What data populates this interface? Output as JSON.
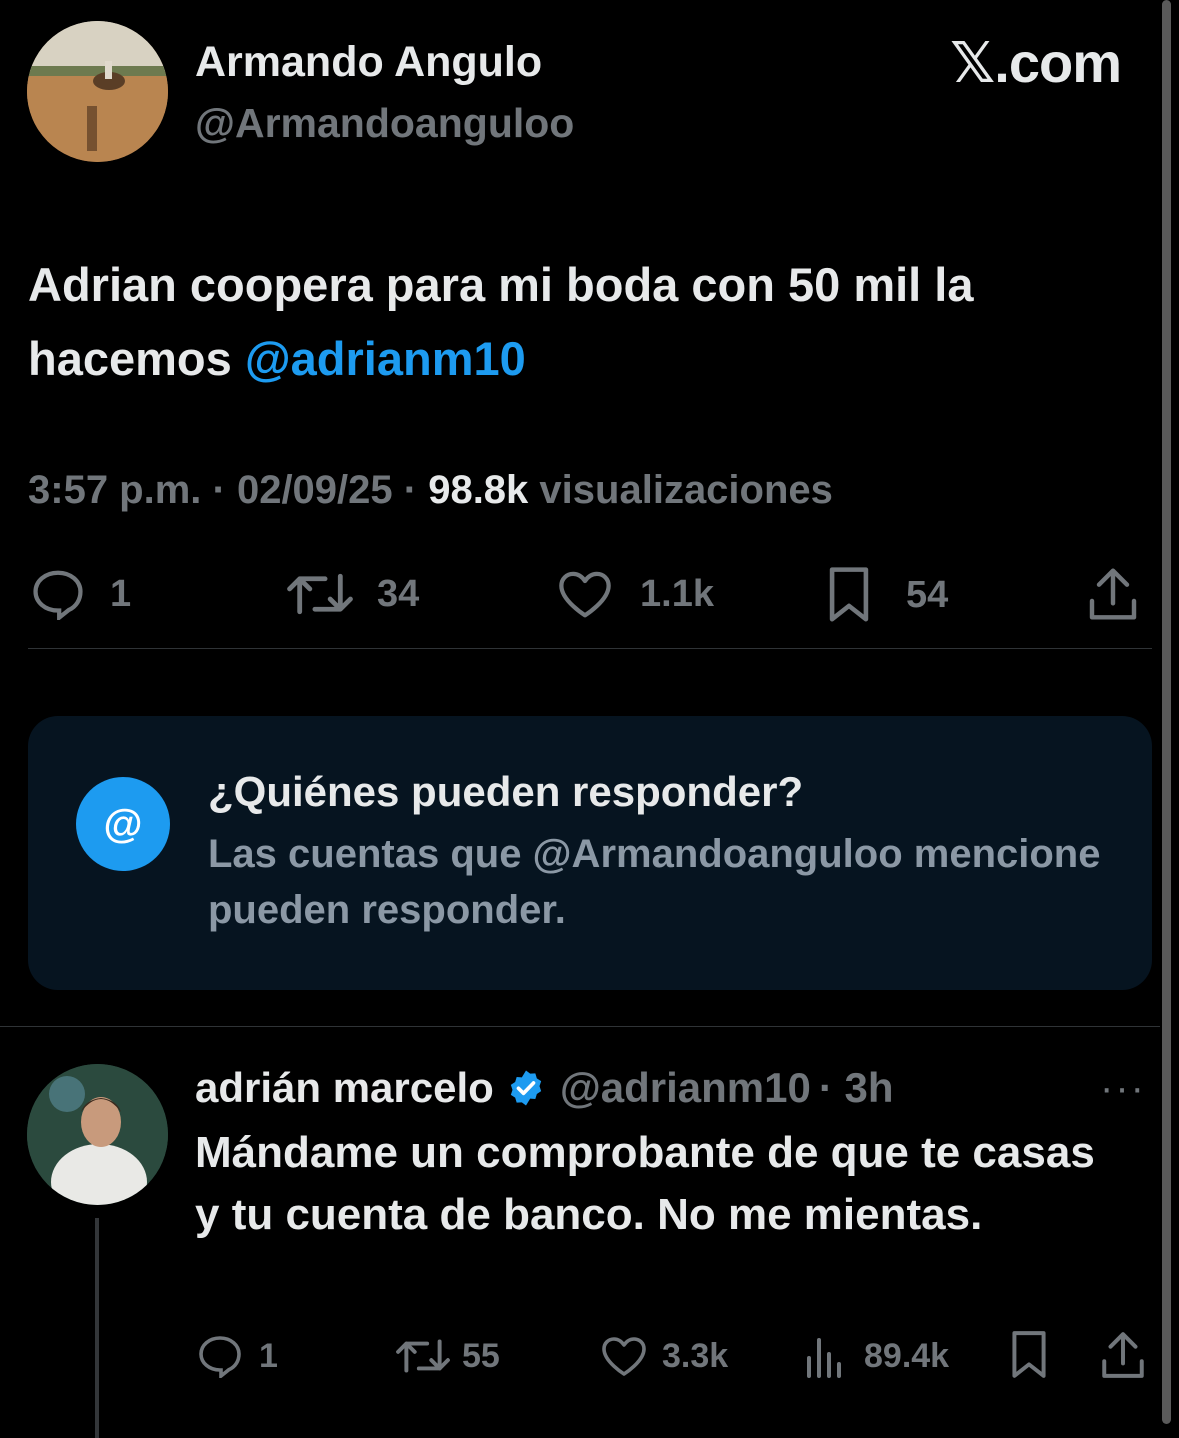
{
  "brand": "𝕏.com",
  "main_tweet": {
    "author_name": "Armando Angulo",
    "author_handle": "@Armandoanguloo",
    "text": "Adrian coopera para mi boda con 50 mil la hacemos ",
    "mention": "@adrianm10",
    "meta_time": "3:57 p.m. · 02/09/25 · ",
    "views_count": "98.8k",
    "views_label": " visualizaciones",
    "replies": "1",
    "reposts": "34",
    "likes": "1.1k",
    "bookmarks": "54"
  },
  "reply_restriction": {
    "icon_glyph": "@",
    "title": "¿Quiénes pueden responder?",
    "subtitle": "Las cuentas que @Armandoanguloo mencione pueden responder."
  },
  "reply": {
    "author_name": "adrián marcelo",
    "author_handle": "@adrianm10",
    "time": "· 3h",
    "more": "···",
    "text": "Mándame un comprobante de que te casas y tu cuenta de banco. No me mientas.",
    "replies": "1",
    "reposts": "55",
    "likes": "3.3k",
    "views": "89.4k"
  },
  "colors": {
    "background": "#000000",
    "accent": "#1d9bf0",
    "muted": "#71767b",
    "box": "#061420"
  }
}
